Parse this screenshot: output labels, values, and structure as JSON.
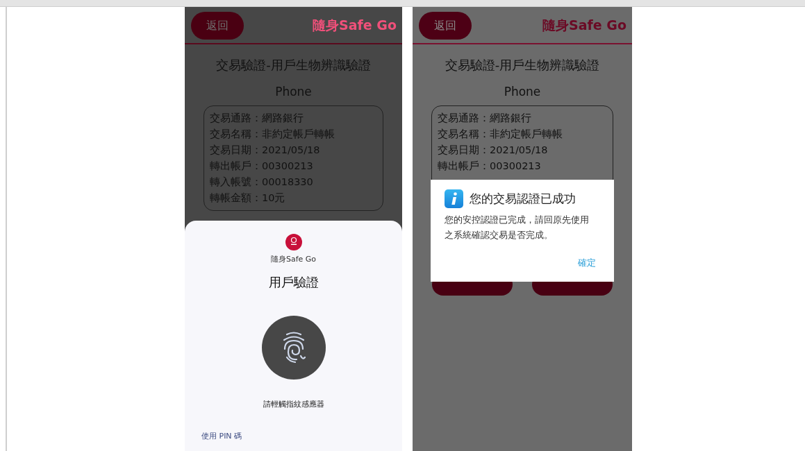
{
  "screens": [
    {
      "kind": "biometric",
      "header": {
        "back_button": "返回",
        "brand": "隨身Safe Go"
      },
      "title": "交易驗證-用戶生物辨識驗證",
      "device": "Phone",
      "details": [
        "交易通路：網路銀行",
        "交易名稱：非約定帳戶轉帳",
        "交易日期：2021/05/18",
        "轉出帳戶：00300213",
        "轉入帳號：00018330",
        "轉帳金額：10元"
      ],
      "sheet": {
        "app_name": "隨身Safe Go",
        "title": "用戶驗證",
        "hint": "請輕觸指紋感應器",
        "alt_action": "使用 PIN 碼"
      }
    },
    {
      "kind": "dialog",
      "header": {
        "back_button": "返回",
        "brand": "隨身Safe Go"
      },
      "title": "交易驗證-用戶生物辨識驗證",
      "device": "Phone",
      "details": [
        "交易通路：網路銀行",
        "交易名稱：非約定帳戶轉帳",
        "交易日期：2021/05/18",
        "轉出帳戶：00300213"
      ],
      "dialog": {
        "title": "您的交易認證已成功",
        "message": "您的安控認證已完成，請回原先使用之系統確認交易是否完成。",
        "button": "確定"
      }
    }
  ]
}
